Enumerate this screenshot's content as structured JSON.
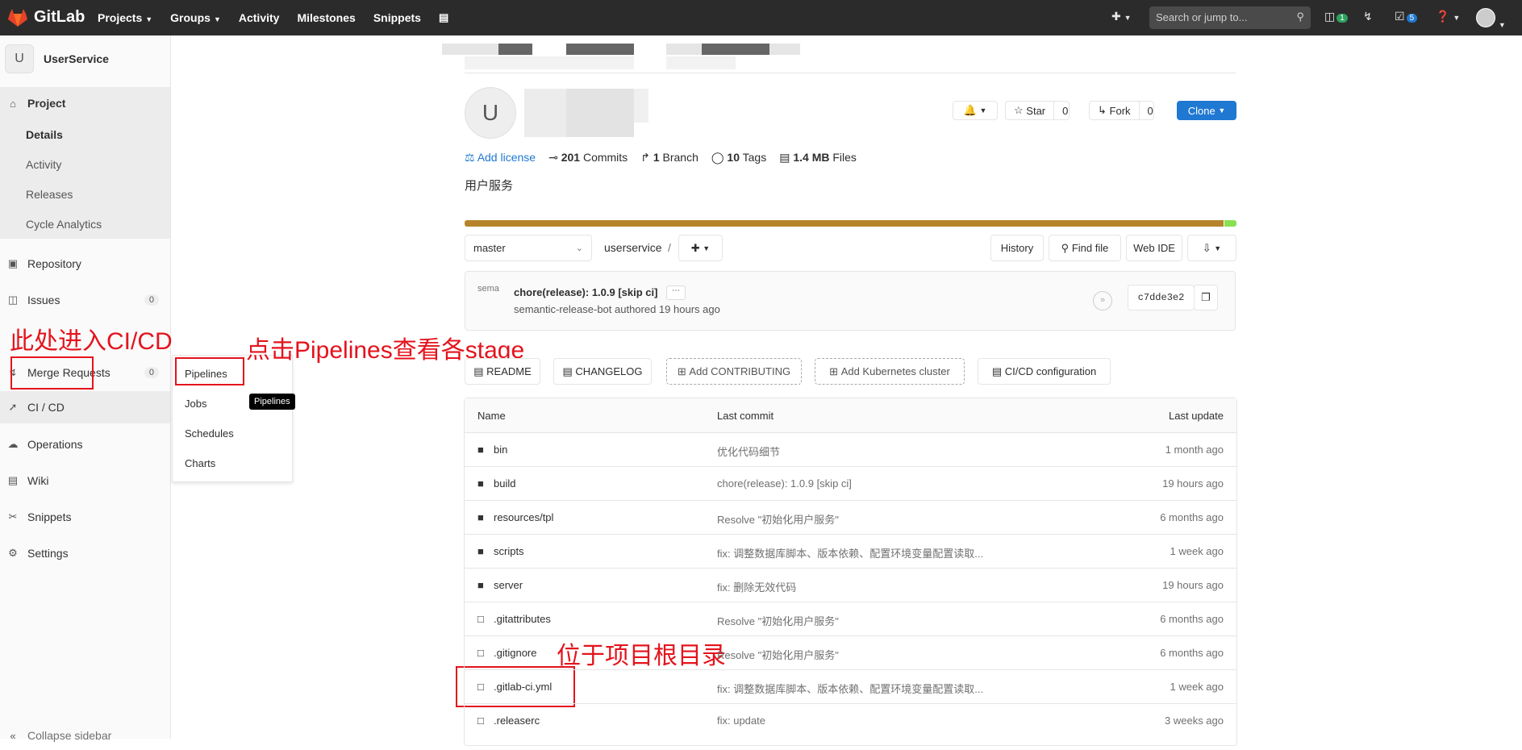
{
  "topbar": {
    "brand": "GitLab",
    "nav": [
      {
        "label": "Projects",
        "dropdown": true
      },
      {
        "label": "Groups",
        "dropdown": true
      },
      {
        "label": "Activity",
        "dropdown": false
      },
      {
        "label": "Milestones",
        "dropdown": false
      },
      {
        "label": "Snippets",
        "dropdown": false
      }
    ],
    "search_placeholder": "Search or jump to...",
    "issues_count": "1",
    "todos_count": "5"
  },
  "sidebar": {
    "avatar_letter": "U",
    "project_name": "UserService",
    "project_label": "Project",
    "project_sub": [
      "Details",
      "Activity",
      "Releases",
      "Cycle Analytics"
    ],
    "items": {
      "repository": "Repository",
      "issues": "Issues",
      "issues_count": "0",
      "merge_requests": "Merge Requests",
      "merge_count": "0",
      "cicd": "CI / CD",
      "operations": "Operations",
      "wiki": "Wiki",
      "snippets": "Snippets",
      "settings": "Settings",
      "collapse": "Collapse sidebar"
    }
  },
  "flyout": {
    "items": [
      "Pipelines",
      "Jobs",
      "Schedules",
      "Charts"
    ],
    "tooltip": "Pipelines"
  },
  "annotations": {
    "cicd": "此处进入CI/CD",
    "pipelines": "点击Pipelines查看各stage",
    "root": "位于项目根目录"
  },
  "project": {
    "avatar_letter": "U",
    "star_label": "Star",
    "star_count": "0",
    "fork_label": "Fork",
    "fork_count": "0",
    "clone_label": "Clone",
    "add_license": "Add license",
    "commits_count": "201",
    "commits_label": "Commits",
    "branch_count": "1",
    "branch_label": "Branch",
    "tags_count": "10",
    "tags_label": "Tags",
    "files_size": "1.4 MB",
    "files_label": "Files",
    "description": "用户服务"
  },
  "toolbar": {
    "branch": "master",
    "path": "userservice",
    "path_sep": "/",
    "history": "History",
    "find_file": "Find file",
    "web_ide": "Web IDE"
  },
  "last_commit": {
    "message": "chore(release): 1.0.9 [skip ci]",
    "author_line": "semantic-release-bot authored 19 hours ago",
    "avatar_alt": "sema",
    "sha": "c7dde3e2"
  },
  "shortcuts": [
    "README",
    "CHANGELOG",
    "Add CONTRIBUTING",
    "Add Kubernetes cluster",
    "CI/CD configuration"
  ],
  "file_table": {
    "headers": {
      "name": "Name",
      "commit": "Last commit",
      "update": "Last update"
    },
    "rows": [
      {
        "type": "folder",
        "name": "bin",
        "commit": "优化代码细节",
        "update": "1 month ago"
      },
      {
        "type": "folder",
        "name": "build",
        "commit": "chore(release): 1.0.9 [skip ci]",
        "update": "19 hours ago"
      },
      {
        "type": "folder",
        "name": "resources/tpl",
        "commit": "Resolve \"初始化用户服务\"",
        "update": "6 months ago"
      },
      {
        "type": "folder",
        "name": "scripts",
        "commit": "fix: 调整数据库脚本、版本依赖、配置环境变量配置读取...",
        "update": "1 week ago"
      },
      {
        "type": "folder",
        "name": "server",
        "commit": "fix: 删除无效代码",
        "update": "19 hours ago"
      },
      {
        "type": "file",
        "name": ".gitattributes",
        "commit": "Resolve \"初始化用户服务\"",
        "update": "6 months ago"
      },
      {
        "type": "file",
        "name": ".gitignore",
        "commit": "Resolve \"初始化用户服务\"",
        "update": "6 months ago"
      },
      {
        "type": "file",
        "name": ".gitlab-ci.yml",
        "commit": "fix: 调整数据库脚本、版本依赖、配置环境变量配置读取...",
        "update": "1 week ago"
      },
      {
        "type": "file",
        "name": ".releaserc",
        "commit": "fix: update",
        "update": "3 weeks ago"
      }
    ]
  },
  "colors": {
    "lang_bar": "#b5842a",
    "lang_bar_end": "#89e051",
    "accent": "#1f78d1",
    "annotation": "#e4131c"
  }
}
